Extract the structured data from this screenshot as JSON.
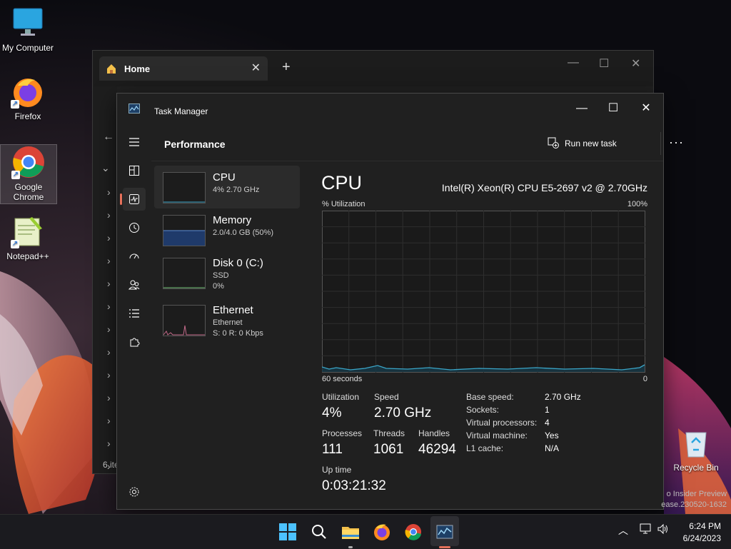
{
  "desktop": {
    "icons": [
      {
        "label": "My Computer"
      },
      {
        "label": "Firefox"
      },
      {
        "label": "Google Chrome"
      },
      {
        "label": "Notepad++"
      },
      {
        "label": "Recycle Bin"
      }
    ],
    "watermark_line1": "o Insider Preview",
    "watermark_line2": "ease.230520-1632"
  },
  "explorer": {
    "tab_label": "Home",
    "status_text": "6 ite"
  },
  "taskmanager": {
    "title": "Task Manager",
    "page_title": "Performance",
    "run_new_task": "Run new task",
    "items": [
      {
        "name": "CPU",
        "sub1": "4%  2.70 GHz",
        "sub2": ""
      },
      {
        "name": "Memory",
        "sub1": "2.0/4.0 GB (50%)",
        "sub2": ""
      },
      {
        "name": "Disk 0 (C:)",
        "sub1": "SSD",
        "sub2": "0%"
      },
      {
        "name": "Ethernet",
        "sub1": "Ethernet",
        "sub2": "S: 0 R: 0 Kbps"
      }
    ],
    "cpu": {
      "title": "CPU",
      "model": "Intel(R) Xeon(R) CPU E5-2697 v2 @ 2.70GHz",
      "util_label": "% Utilization",
      "max_label": "100%",
      "time_label": "60 seconds",
      "min_label": "0",
      "stats": {
        "utilization_label": "Utilization",
        "utilization": "4%",
        "speed_label": "Speed",
        "speed": "2.70 GHz",
        "processes_label": "Processes",
        "processes": "111",
        "threads_label": "Threads",
        "threads": "1061",
        "handles_label": "Handles",
        "handles": "46294",
        "uptime_label": "Up time",
        "uptime": "0:03:21:32"
      },
      "specs": [
        {
          "k": "Base speed:",
          "v": "2.70 GHz"
        },
        {
          "k": "Sockets:",
          "v": "1"
        },
        {
          "k": "Virtual processors:",
          "v": "4"
        },
        {
          "k": "Virtual machine:",
          "v": "Yes"
        },
        {
          "k": "L1 cache:",
          "v": "N/A"
        }
      ]
    }
  },
  "taskbar": {
    "time": "6:24 PM",
    "date": "6/24/2023"
  },
  "colors": {
    "accent": "#e6705a",
    "cpu_line": "#3aa6c8",
    "memory_fill": "#1f3a6a",
    "ethernet_line": "#c46a8a"
  }
}
